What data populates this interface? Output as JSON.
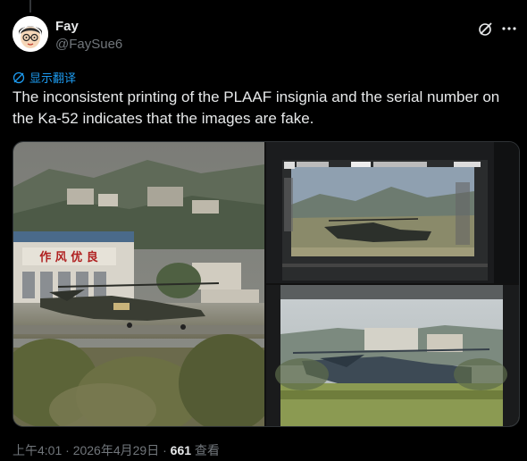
{
  "author": {
    "name": "Fay",
    "handle": "@FaySue6"
  },
  "translate_label": "显示翻译",
  "tweet_text": "The inconsistent printing of the PLAAF insignia and the serial number on the Ka-52 indicates that the images are fake.",
  "photos": {
    "left": {
      "sign_text": "作 风 优 良"
    }
  },
  "meta": {
    "time": "上午4:01",
    "sep1": " · ",
    "date": "2026年4月29日",
    "sep2": " · ",
    "views_count": "661",
    "views_label": " 查看"
  },
  "icons": {
    "grok": "grok-icon",
    "more": "more-icon",
    "translate": "globe-icon"
  },
  "colors": {
    "background": "#000000",
    "text": "#e7e9ea",
    "secondary": "#71767b",
    "accent": "#1d9bf0"
  }
}
